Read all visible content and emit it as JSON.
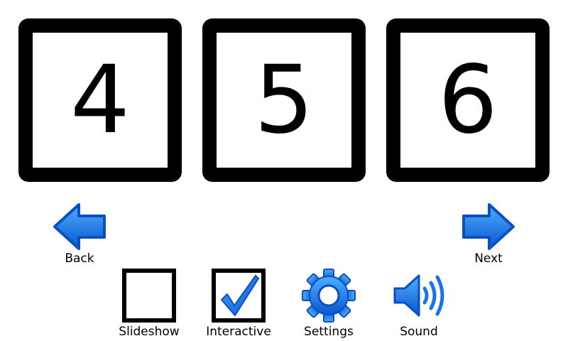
{
  "cards": [
    {
      "number": "4"
    },
    {
      "number": "5"
    },
    {
      "number": "6"
    }
  ],
  "nav": {
    "back_label": "Back",
    "next_label": "Next"
  },
  "toolbar": {
    "slideshow_label": "Slideshow",
    "slideshow_checked": false,
    "interactive_label": "Interactive",
    "interactive_checked": true,
    "settings_label": "Settings",
    "sound_label": "Sound"
  },
  "colors": {
    "accent": "#1a73e8",
    "accent_light": "#3fa0ff",
    "accent_dark": "#0b4fc0",
    "card_border": "#000000"
  }
}
